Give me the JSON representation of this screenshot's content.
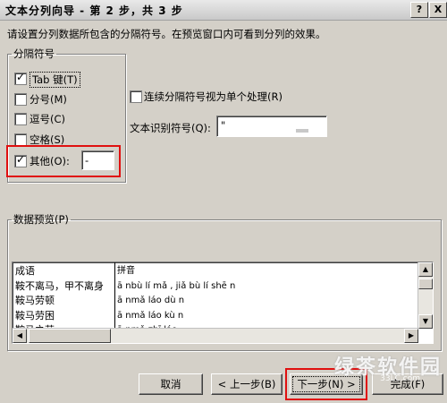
{
  "window": {
    "title": "文本分列向导 - 第 2 步，共 3 步",
    "help_btn": "?",
    "close_btn": "X"
  },
  "instruction": "请设置分列数据所包含的分隔符号。在预览窗口内可看到分列的效果。",
  "delimiters": {
    "legend": "分隔符号",
    "tab": {
      "label": "Tab 键(T)",
      "checked": true
    },
    "semicolon": {
      "label": "分号(M)",
      "checked": false
    },
    "comma": {
      "label": "逗号(C)",
      "checked": false
    },
    "space": {
      "label": "空格(S)",
      "checked": false
    },
    "other": {
      "label": "其他(O):",
      "checked": true,
      "value": "-"
    }
  },
  "consecutive": {
    "label": "连续分隔符号视为单个处理(R)",
    "checked": false
  },
  "text_qualifier": {
    "label": "文本识别符号(Q):",
    "value": "\""
  },
  "preview": {
    "legend": "数据预览(P)",
    "rows": [
      [
        "成语",
        "拼音"
      ],
      [
        "鞍不离马，甲不离身",
        "ā nbù lí mǎ , jiǎ bù lí shē n"
      ],
      [
        "鞍马劳顿",
        "ā nmǎ láo dù n"
      ],
      [
        "鞍马劳困",
        "ā nmǎ láo kù n"
      ],
      [
        "鞍马之劳",
        "ā nmǎ zhī láo"
      ]
    ]
  },
  "buttons": {
    "cancel": "取消",
    "back": "< 上一步(B)",
    "next": "下一步(N) >",
    "finish": "完成(F)"
  },
  "watermark": {
    "text": "绿茶软件园",
    "url": "33LC.com"
  }
}
